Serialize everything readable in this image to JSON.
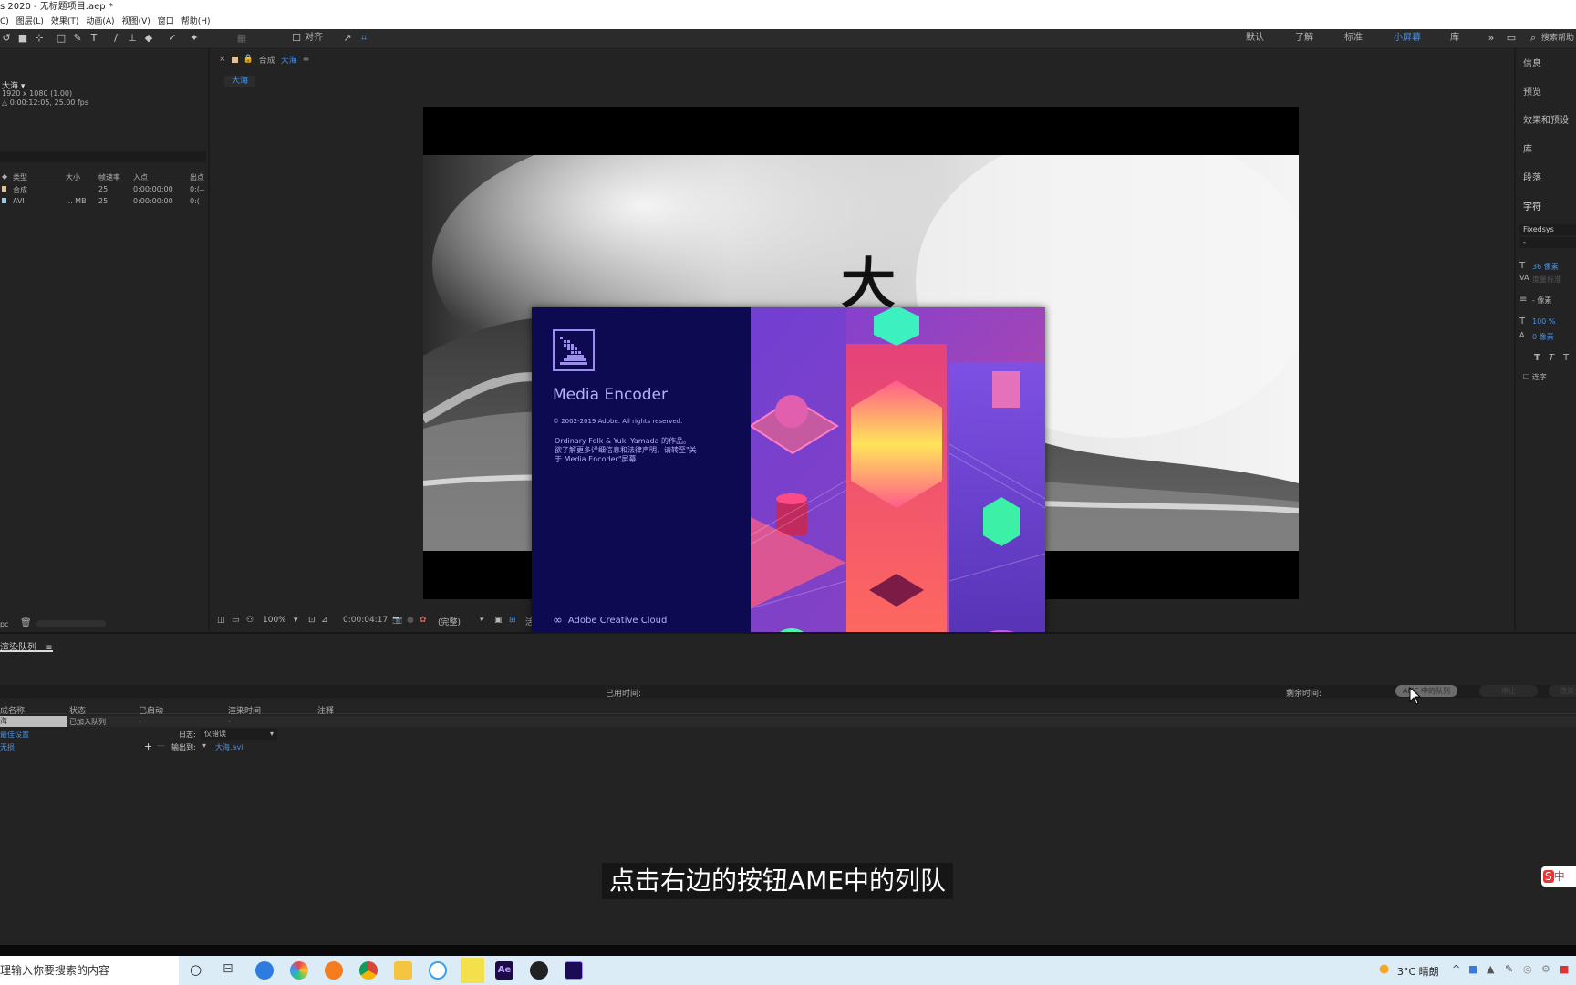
{
  "window": {
    "title": "s 2020 - 无标题项目.aep *"
  },
  "menu": [
    "C)",
    "图层(L)",
    "效果(T)",
    "动画(A)",
    "视图(V)",
    "窗口",
    "帮助(H)"
  ],
  "toolbar": {
    "align_label": "对齐",
    "workspaces": [
      "默认",
      "了解",
      "标准",
      "小屏幕",
      "库"
    ],
    "active_workspace": "小屏幕",
    "search_placeholder": "搜索帮助"
  },
  "project": {
    "comp_name": "大海",
    "comp_info1": "1920 x 1080 (1.00)",
    "comp_info2": "△ 0:00:12:05, 25.00 fps",
    "columns": [
      "类型",
      "大小",
      "帧速率",
      "入点",
      "出点"
    ],
    "rows": [
      {
        "type": "合成",
        "size": "",
        "fps": "25",
        "in": "0:00:00:00",
        "out": "0:("
      },
      {
        "type": "AVI",
        "size": "... MB",
        "fps": "25",
        "in": "0:00:00:00",
        "out": "0:("
      }
    ],
    "bpc": "pc"
  },
  "viewer": {
    "tab_label": "合成",
    "tab_comp": "大海",
    "breadcrumb": "大海",
    "zoom": "100%",
    "timecode": "0:00:04:17",
    "quality": "(完整)",
    "extra": "活"
  },
  "right_panel": {
    "items": [
      "信息",
      "预览",
      "效果和预设",
      "库",
      "段落",
      "字符"
    ],
    "font": "Fixedsys",
    "font_style": "-",
    "font_size": "36 像素",
    "leading": "度量标准",
    "tracking": "- 像素",
    "vscale": "100 %",
    "baseline": "0 像素",
    "ligature": "连字"
  },
  "render_queue": {
    "tab": "渲染队列",
    "elapsed_label": "已用时间:",
    "remaining_label": "剩余时间:",
    "ame_button": "AME 中的队列",
    "stop_button": "停止",
    "render_button": "渲染",
    "columns": [
      "成名称",
      "状态",
      "已启动",
      "渲染时间",
      "注释"
    ],
    "item": {
      "name": "海",
      "status": "已加入队列",
      "started": "-",
      "render_time": "-",
      "settings_label": "最佳设置",
      "log_label": "日志:",
      "log_value": "仅错误",
      "module_label": "无损",
      "output_label": "输出到:",
      "output_value": "大海.avi"
    }
  },
  "splash": {
    "app_name": "Media Encoder",
    "copyright": "© 2002-2019 Adobe. All rights reserved.",
    "credit1": "Ordinary Folk & Yuki Yamada 的作品。",
    "credit2": "欲了解更多详细信息和法律声明，请转至\"关",
    "credit3": "于 Media Encoder\"屏幕",
    "cc_label": "Adobe Creative Cloud"
  },
  "comp_title_char": "大",
  "subtitle": "点击右边的按钮AME中的列队",
  "taskbar": {
    "search_placeholder": "理输入你要搜索的内容",
    "weather": "3°C 晴朗",
    "ime": "中"
  },
  "colors": {
    "accent": "#4a90e2",
    "panel": "#232323",
    "splash_bg": "#0e0a52"
  }
}
